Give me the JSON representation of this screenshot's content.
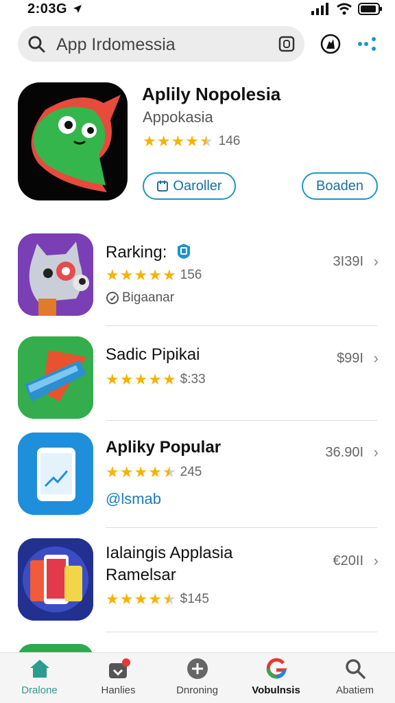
{
  "status_bar": {
    "time": "2:03G"
  },
  "search": {
    "text": "App Irdomessia"
  },
  "featured": {
    "title": "Aplily Nopolesia",
    "subtitle": "Appokasia",
    "rating": 4.5,
    "rating_text": "146",
    "button_left": "Oaroller",
    "button_right": "Boaden"
  },
  "apps": [
    {
      "title": "Rarking:",
      "rating": 5,
      "rating_text": "156",
      "price": "3I39I",
      "meta": "Bigaanar"
    },
    {
      "title": "Sadic Pipikai",
      "rating": 5,
      "rating_text": "$:33",
      "price": "$99I"
    },
    {
      "title": "Apliky Popular",
      "rating": 4.5,
      "rating_text": "245",
      "price": "36.90I",
      "link": "@lsmab"
    },
    {
      "title_line1": "Ialaingis Applasia",
      "title_line2": "Ramelsar",
      "rating": 4.5,
      "rating_text": "$145",
      "price": "€20II"
    }
  ],
  "tabs": [
    {
      "label": "Dralone",
      "icon": "home-icon"
    },
    {
      "label": "Hanlies",
      "icon": "inbox-icon"
    },
    {
      "label": "Dnroning",
      "icon": "plus-circle-icon"
    },
    {
      "label": "Vobulnsis",
      "icon": "colorful-g-icon"
    },
    {
      "label": "Abatiem",
      "icon": "search-icon"
    }
  ]
}
